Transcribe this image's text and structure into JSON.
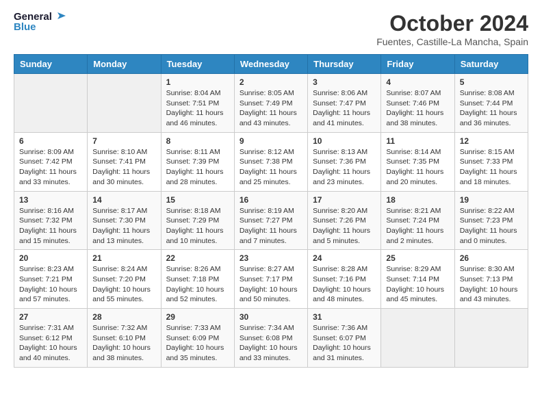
{
  "header": {
    "logo_line1": "General",
    "logo_line2": "Blue",
    "month_title": "October 2024",
    "subtitle": "Fuentes, Castille-La Mancha, Spain"
  },
  "weekdays": [
    "Sunday",
    "Monday",
    "Tuesday",
    "Wednesday",
    "Thursday",
    "Friday",
    "Saturday"
  ],
  "weeks": [
    [
      {
        "day": "",
        "empty": true
      },
      {
        "day": "",
        "empty": true
      },
      {
        "day": "1",
        "sunrise": "8:04 AM",
        "sunset": "7:51 PM",
        "daylight": "11 hours and 46 minutes."
      },
      {
        "day": "2",
        "sunrise": "8:05 AM",
        "sunset": "7:49 PM",
        "daylight": "11 hours and 43 minutes."
      },
      {
        "day": "3",
        "sunrise": "8:06 AM",
        "sunset": "7:47 PM",
        "daylight": "11 hours and 41 minutes."
      },
      {
        "day": "4",
        "sunrise": "8:07 AM",
        "sunset": "7:46 PM",
        "daylight": "11 hours and 38 minutes."
      },
      {
        "day": "5",
        "sunrise": "8:08 AM",
        "sunset": "7:44 PM",
        "daylight": "11 hours and 36 minutes."
      }
    ],
    [
      {
        "day": "6",
        "sunrise": "8:09 AM",
        "sunset": "7:42 PM",
        "daylight": "11 hours and 33 minutes."
      },
      {
        "day": "7",
        "sunrise": "8:10 AM",
        "sunset": "7:41 PM",
        "daylight": "11 hours and 30 minutes."
      },
      {
        "day": "8",
        "sunrise": "8:11 AM",
        "sunset": "7:39 PM",
        "daylight": "11 hours and 28 minutes."
      },
      {
        "day": "9",
        "sunrise": "8:12 AM",
        "sunset": "7:38 PM",
        "daylight": "11 hours and 25 minutes."
      },
      {
        "day": "10",
        "sunrise": "8:13 AM",
        "sunset": "7:36 PM",
        "daylight": "11 hours and 23 minutes."
      },
      {
        "day": "11",
        "sunrise": "8:14 AM",
        "sunset": "7:35 PM",
        "daylight": "11 hours and 20 minutes."
      },
      {
        "day": "12",
        "sunrise": "8:15 AM",
        "sunset": "7:33 PM",
        "daylight": "11 hours and 18 minutes."
      }
    ],
    [
      {
        "day": "13",
        "sunrise": "8:16 AM",
        "sunset": "7:32 PM",
        "daylight": "11 hours and 15 minutes."
      },
      {
        "day": "14",
        "sunrise": "8:17 AM",
        "sunset": "7:30 PM",
        "daylight": "11 hours and 13 minutes."
      },
      {
        "day": "15",
        "sunrise": "8:18 AM",
        "sunset": "7:29 PM",
        "daylight": "11 hours and 10 minutes."
      },
      {
        "day": "16",
        "sunrise": "8:19 AM",
        "sunset": "7:27 PM",
        "daylight": "11 hours and 7 minutes."
      },
      {
        "day": "17",
        "sunrise": "8:20 AM",
        "sunset": "7:26 PM",
        "daylight": "11 hours and 5 minutes."
      },
      {
        "day": "18",
        "sunrise": "8:21 AM",
        "sunset": "7:24 PM",
        "daylight": "11 hours and 2 minutes."
      },
      {
        "day": "19",
        "sunrise": "8:22 AM",
        "sunset": "7:23 PM",
        "daylight": "11 hours and 0 minutes."
      }
    ],
    [
      {
        "day": "20",
        "sunrise": "8:23 AM",
        "sunset": "7:21 PM",
        "daylight": "10 hours and 57 minutes."
      },
      {
        "day": "21",
        "sunrise": "8:24 AM",
        "sunset": "7:20 PM",
        "daylight": "10 hours and 55 minutes."
      },
      {
        "day": "22",
        "sunrise": "8:26 AM",
        "sunset": "7:18 PM",
        "daylight": "10 hours and 52 minutes."
      },
      {
        "day": "23",
        "sunrise": "8:27 AM",
        "sunset": "7:17 PM",
        "daylight": "10 hours and 50 minutes."
      },
      {
        "day": "24",
        "sunrise": "8:28 AM",
        "sunset": "7:16 PM",
        "daylight": "10 hours and 48 minutes."
      },
      {
        "day": "25",
        "sunrise": "8:29 AM",
        "sunset": "7:14 PM",
        "daylight": "10 hours and 45 minutes."
      },
      {
        "day": "26",
        "sunrise": "8:30 AM",
        "sunset": "7:13 PM",
        "daylight": "10 hours and 43 minutes."
      }
    ],
    [
      {
        "day": "27",
        "sunrise": "7:31 AM",
        "sunset": "6:12 PM",
        "daylight": "10 hours and 40 minutes."
      },
      {
        "day": "28",
        "sunrise": "7:32 AM",
        "sunset": "6:10 PM",
        "daylight": "10 hours and 38 minutes."
      },
      {
        "day": "29",
        "sunrise": "7:33 AM",
        "sunset": "6:09 PM",
        "daylight": "10 hours and 35 minutes."
      },
      {
        "day": "30",
        "sunrise": "7:34 AM",
        "sunset": "6:08 PM",
        "daylight": "10 hours and 33 minutes."
      },
      {
        "day": "31",
        "sunrise": "7:36 AM",
        "sunset": "6:07 PM",
        "daylight": "10 hours and 31 minutes."
      },
      {
        "day": "",
        "empty": true
      },
      {
        "day": "",
        "empty": true
      }
    ]
  ]
}
